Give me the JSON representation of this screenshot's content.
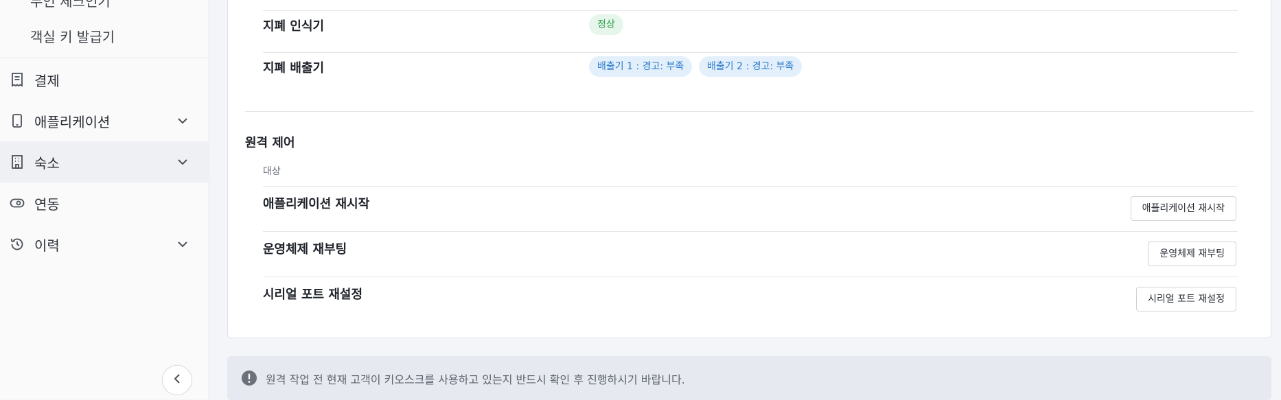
{
  "sidebar": {
    "cut_item": "무인 체크인기",
    "sub_item": "객실 키 발급기",
    "nav": [
      {
        "label": "결제",
        "icon": "receipt-icon",
        "expandable": false
      },
      {
        "label": "애플리케이션",
        "icon": "tablet-icon",
        "expandable": true
      },
      {
        "label": "숙소",
        "icon": "building-icon",
        "expandable": true,
        "active": true
      },
      {
        "label": "연동",
        "icon": "eye-icon",
        "expandable": false
      },
      {
        "label": "이력",
        "icon": "history-icon",
        "expandable": true
      }
    ],
    "collapse_icon": "chevron-left-icon"
  },
  "devices": [
    {
      "label": "지폐 인식기",
      "badges": [
        {
          "text": "정상",
          "color": "#2f9e4f"
        }
      ]
    },
    {
      "label": "지폐 배출기",
      "badges": [
        {
          "text": "배출기 1 : 경고: 부족",
          "color": "#2677c9"
        },
        {
          "text": "배출기 2 : 경고: 부족",
          "color": "#2677c9"
        }
      ]
    }
  ],
  "remote": {
    "title": "원격 제어",
    "column_header": "대상",
    "rows": [
      {
        "label": "애플리케이션 재시작",
        "button": "애플리케이션 재시작"
      },
      {
        "label": "운영체제 재부팅",
        "button": "운영체제 재부팅"
      },
      {
        "label": "시리얼 포트 재설정",
        "button": "시리얼 포트 재설정"
      }
    ]
  },
  "notice": {
    "icon": "exclamation-circle-icon",
    "text": "원격 작업 전 현재 고객이 키오스크를 사용하고 있는지 반드시 확인 후 진행하시기 바랍니다."
  }
}
